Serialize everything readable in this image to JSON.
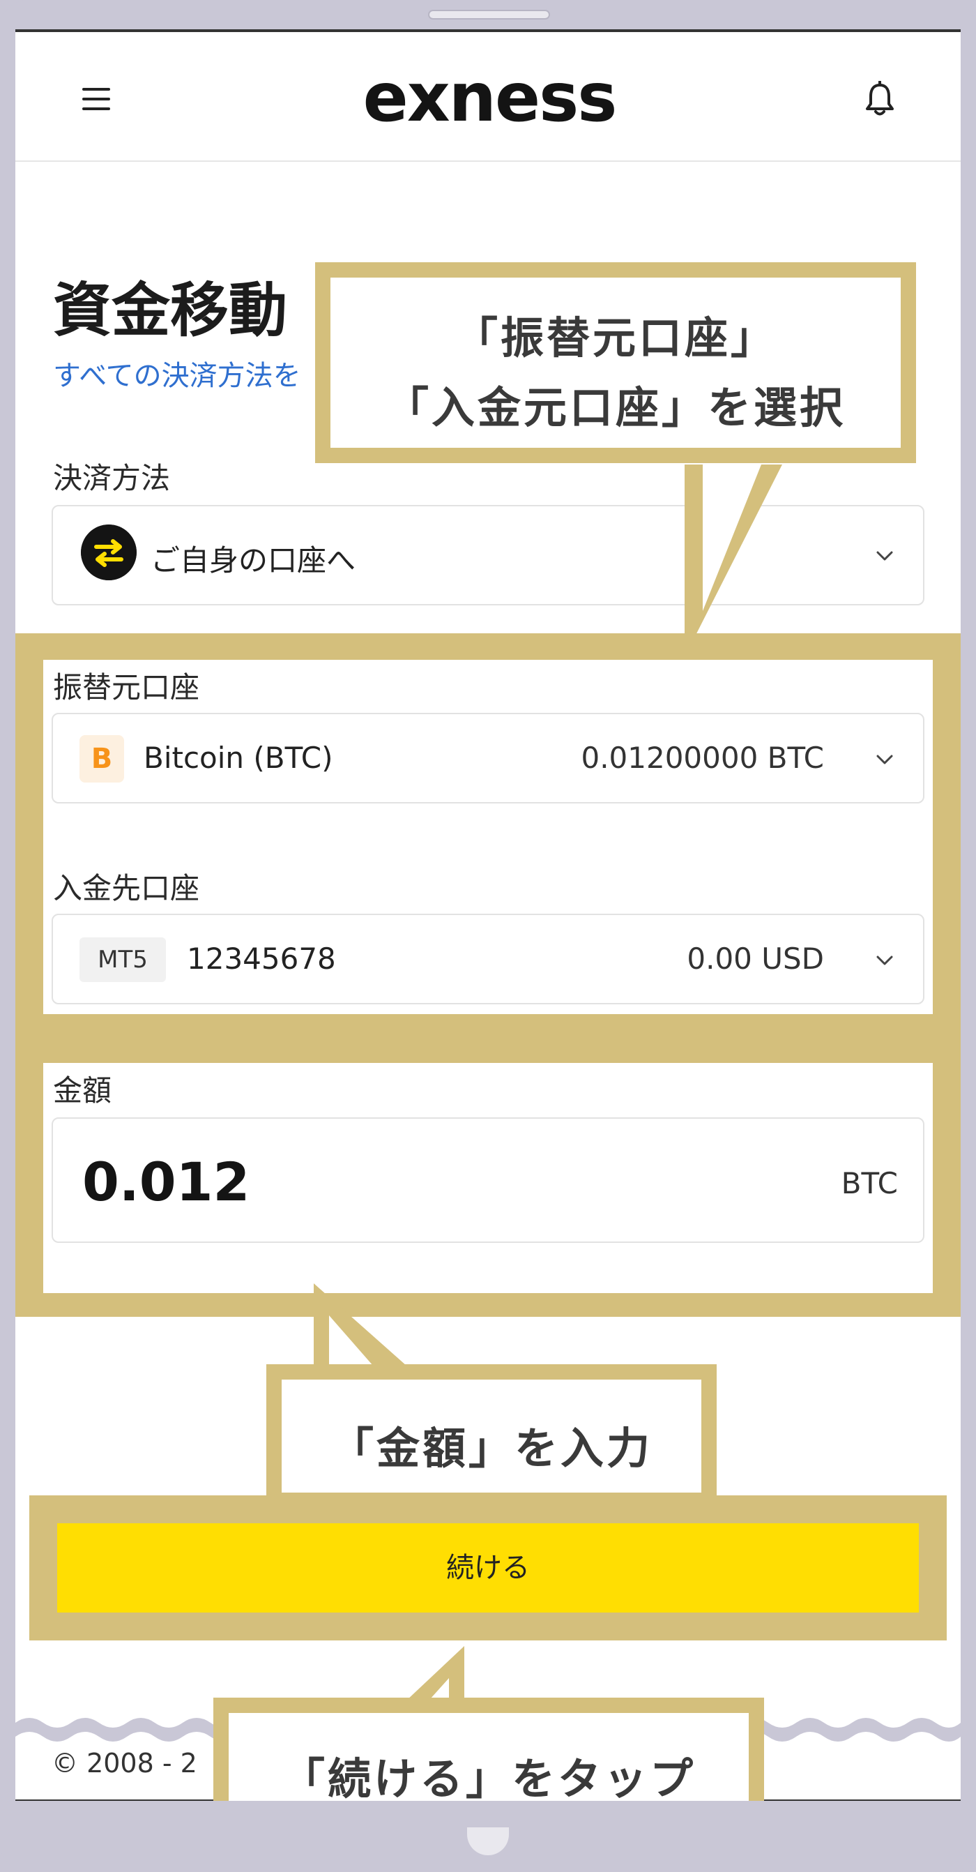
{
  "header": {
    "logo": "exness"
  },
  "page": {
    "title": "資金移動",
    "link_text": "すべての決済方法を"
  },
  "payment_method": {
    "label": "決済方法",
    "value": "ご自身の口座へ"
  },
  "from_account": {
    "label": "振替元口座",
    "name": "Bitcoin (BTC)",
    "balance": "0.01200000 BTC",
    "icon_glyph": "B"
  },
  "to_account": {
    "label": "入金先口座",
    "badge": "MT5",
    "number": "12345678",
    "balance": "0.00 USD"
  },
  "amount": {
    "label": "金額",
    "value": "0.012",
    "unit": "BTC"
  },
  "continue_button": {
    "label": "続ける"
  },
  "footer": {
    "copyright": "© 2008 - 2"
  },
  "annotations": {
    "select_line1": "「振替元口座」",
    "select_line2": "「入金元口座」を選択",
    "amount": "「金額」を入力",
    "tap": "「続ける」をタップ"
  },
  "colors": {
    "highlight": "#d4bf7c",
    "button": "#ffde02",
    "link": "#2f6fcf",
    "btc": "#f7931a"
  }
}
